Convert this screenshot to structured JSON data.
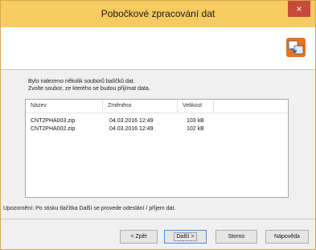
{
  "window": {
    "title": "Pobočkové zpracování dat",
    "close_glyph": "×",
    "accent_color": "#f6cb5f",
    "close_color": "#c74a3a"
  },
  "header": {
    "icon": "app-logo-icon"
  },
  "instructions": {
    "line1": "Bylo nalezeno několik souborů balíčků dat.",
    "line2": "Zvolte soubor, ze kterého se budou přijímat data."
  },
  "files": {
    "columns": [
      "Název",
      "Změněno",
      "Velikost"
    ],
    "rows": [
      {
        "name": "CNT2PHA003.zip",
        "modified": "04.03.2016 12:49",
        "size": "103  kB"
      },
      {
        "name": "CNT2PHA002.zip",
        "modified": "04.03.2016 12:49",
        "size": "102  kB"
      }
    ]
  },
  "note": "Upozornění: Po stisku tlačítka Další se provede odeslání / příjem dat.",
  "buttons": {
    "back": "< Zpět",
    "next": "Další >",
    "cancel": "Storno",
    "help": "Nápověda"
  }
}
